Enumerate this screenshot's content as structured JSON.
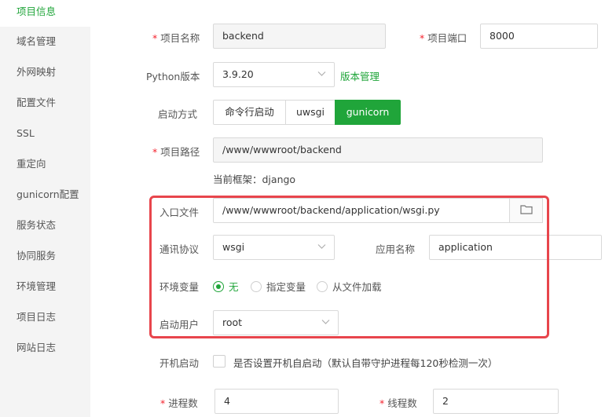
{
  "sidebar": {
    "items": [
      {
        "label": "项目信息",
        "active": true
      },
      {
        "label": "域名管理"
      },
      {
        "label": "外网映射"
      },
      {
        "label": "配置文件"
      },
      {
        "label": "SSL"
      },
      {
        "label": "重定向"
      },
      {
        "label": "gunicorn配置"
      },
      {
        "label": "服务状态"
      },
      {
        "label": "协同服务"
      },
      {
        "label": "环境管理"
      },
      {
        "label": "项目日志"
      },
      {
        "label": "网站日志"
      }
    ]
  },
  "form": {
    "required_mark": "*",
    "project_name": {
      "label": "项目名称",
      "value": "backend"
    },
    "project_port": {
      "label": "项目端口",
      "value": "8000"
    },
    "python_version": {
      "label": "Python版本",
      "value": "3.9.20",
      "manage_link": "版本管理"
    },
    "start_mode": {
      "label": "启动方式",
      "options": [
        "命令行启动",
        "uwsgi",
        "gunicorn"
      ],
      "selected": "gunicorn"
    },
    "project_path": {
      "label": "项目路径",
      "value": "/www/wwwroot/backend"
    },
    "framework_note": "当前框架：django",
    "entry_file": {
      "label": "入口文件",
      "value": "/www/wwwroot/backend/application/wsgi.py"
    },
    "protocol": {
      "label": "通讯协议",
      "value": "wsgi"
    },
    "app_name": {
      "label": "应用名称",
      "value": "application"
    },
    "env_vars": {
      "label": "环境变量",
      "options": [
        "无",
        "指定变量",
        "从文件加载"
      ],
      "selected": "无"
    },
    "run_user": {
      "label": "启动用户",
      "value": "root"
    },
    "autostart": {
      "label": "开机启动",
      "hint": "是否设置开机自启动（默认自带守护进程每120秒检测一次）",
      "checked": false
    },
    "processes": {
      "label": "进程数",
      "value": "4"
    },
    "threads": {
      "label": "线程数",
      "value": "2"
    }
  },
  "colors": {
    "accent": "#20a53a",
    "highlight": "#e8454c",
    "required": "#f5222d"
  }
}
